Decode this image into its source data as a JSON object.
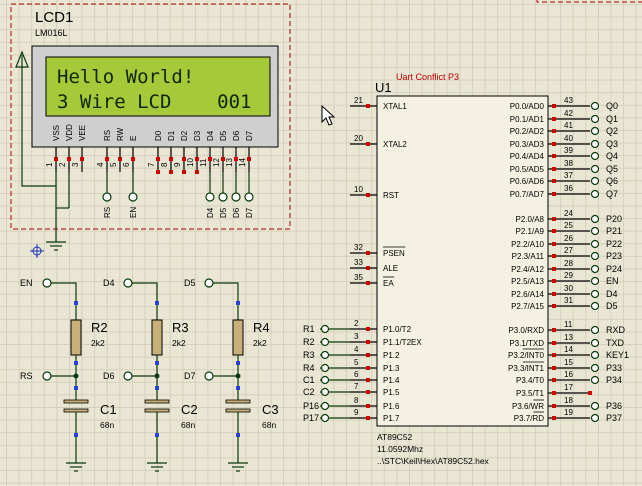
{
  "lcd": {
    "ref": "LCD1",
    "model": "LM016L",
    "line1": "Hello World!",
    "line2": "3 Wire LCD    001",
    "pins": [
      "VSS",
      "VDD",
      "VEE",
      "RS",
      "RW",
      "E",
      "D0",
      "D1",
      "D2",
      "D3",
      "D4",
      "D5",
      "D6",
      "D7"
    ],
    "pin_numbers": [
      "1",
      "2",
      "3",
      "4",
      "5",
      "6",
      "7",
      "8",
      "9",
      "10",
      "11",
      "12",
      "13",
      "14"
    ],
    "bus_labels": [
      "RS",
      "EN",
      "D4",
      "D5",
      "D6",
      "D7"
    ]
  },
  "mcu": {
    "ref": "U1",
    "conflict": "Uart Conflict P3",
    "part": "AT89C52",
    "clock": "11.0592Mhz",
    "hexfile": "..\\STC\\Keil\\Hex\\AT89C52.hex",
    "left_pins": [
      {
        "num": "21",
        "name": "XTAL1",
        "net": ""
      },
      {
        "num": "20",
        "name": "XTAL2",
        "net": ""
      },
      {
        "num": "10",
        "name": "RST",
        "net": ""
      },
      {
        "num": "32",
        "name": "PSEN",
        "net": ""
      },
      {
        "num": "33",
        "name": "ALE",
        "net": ""
      },
      {
        "num": "35",
        "name": "EA",
        "net": ""
      },
      {
        "num": "2",
        "name": "P1.0/T2",
        "net": "R1"
      },
      {
        "num": "3",
        "name": "P1.1/T2EX",
        "net": "R2"
      },
      {
        "num": "4",
        "name": "P1.2",
        "net": "R3"
      },
      {
        "num": "5",
        "name": "P1.3",
        "net": "R4"
      },
      {
        "num": "6",
        "name": "P1.4",
        "net": "C1"
      },
      {
        "num": "7",
        "name": "P1.5",
        "net": "C2"
      },
      {
        "num": "8",
        "name": "P1.6",
        "net": "P16"
      },
      {
        "num": "9",
        "name": "P1.7",
        "net": "P17"
      }
    ],
    "right_pins": [
      {
        "num": "43",
        "name": "P0.0/AD0",
        "net": "Q0"
      },
      {
        "num": "42",
        "name": "P0.1/AD1",
        "net": "Q1"
      },
      {
        "num": "41",
        "name": "P0.2/AD2",
        "net": "Q2"
      },
      {
        "num": "40",
        "name": "P0.3/AD3",
        "net": "Q3"
      },
      {
        "num": "39",
        "name": "P0.4/AD4",
        "net": "Q4"
      },
      {
        "num": "38",
        "name": "P0.5/AD5",
        "net": "Q5"
      },
      {
        "num": "37",
        "name": "P0.6/AD6",
        "net": "Q6"
      },
      {
        "num": "36",
        "name": "P0.7/AD7",
        "net": "Q7"
      },
      {
        "num": "24",
        "name": "P2.0/A8",
        "net": "P20"
      },
      {
        "num": "25",
        "name": "P2.1/A9",
        "net": "P21"
      },
      {
        "num": "26",
        "name": "P2.2/A10",
        "net": "P22"
      },
      {
        "num": "27",
        "name": "P2.3/A11",
        "net": "P23"
      },
      {
        "num": "28",
        "name": "P2.4/A12",
        "net": "P24"
      },
      {
        "num": "29",
        "name": "P2.5/A13",
        "net": "EN"
      },
      {
        "num": "30",
        "name": "P2.6/A14",
        "net": "D4"
      },
      {
        "num": "31",
        "name": "P2.7/A15",
        "net": "D5"
      },
      {
        "num": "11",
        "name": "P3.0/RXD",
        "net": "RXD"
      },
      {
        "num": "13",
        "name": "P3.1/TXD",
        "net": "TXD"
      },
      {
        "num": "14",
        "name": "P3.2/INT0",
        "net": "KEY1"
      },
      {
        "num": "15",
        "name": "P3.3/INT1",
        "net": "P33"
      },
      {
        "num": "16",
        "name": "P3.4/T0",
        "net": "P34"
      },
      {
        "num": "17",
        "name": "P3.5/T1",
        "net": ""
      },
      {
        "num": "18",
        "name": "P3.6/WR",
        "net": "P36"
      },
      {
        "num": "19",
        "name": "P3.7/RD",
        "net": "P37"
      }
    ]
  },
  "rc": [
    {
      "in": "EN",
      "mid": "RS",
      "r_ref": "R2",
      "r_val": "2k2",
      "c_ref": "C1",
      "c_val": "68n"
    },
    {
      "in": "D4",
      "mid": "D6",
      "r_ref": "R3",
      "r_val": "2k2",
      "c_ref": "C2",
      "c_val": "68n"
    },
    {
      "in": "D5",
      "mid": "D7",
      "r_ref": "R4",
      "r_val": "2k2",
      "c_ref": "C3",
      "c_val": "68n"
    }
  ]
}
